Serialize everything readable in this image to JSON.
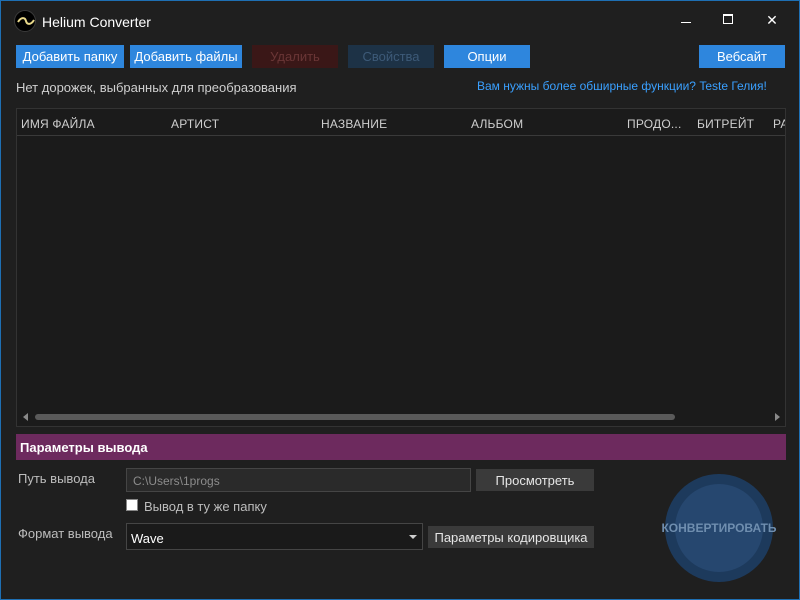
{
  "window": {
    "title": "Helium Converter"
  },
  "toolbar": {
    "add_folder": "Добавить папку",
    "add_files": "Добавить файлы",
    "delete": "Удалить",
    "properties": "Свойства",
    "options": "Опции",
    "website": "Вебсайт"
  },
  "status": {
    "no_tracks": "Нет дорожек, выбранных для преобразования",
    "promo_link": "Вам нужны более обширные функции? Teste Гелия!"
  },
  "tracklist": {
    "columns": [
      "ИМЯ ФАЙЛА",
      "АРТИСТ",
      "НАЗВАНИЕ",
      "АЛЬБОМ",
      "ПРОДО...",
      "БИТРЕЙТ",
      "РА"
    ]
  },
  "output": {
    "section_title": "Параметры вывода",
    "path_label": "Путь вывода",
    "path_value": "C:\\Users\\1progs",
    "browse_button": "Просмотреть",
    "same_folder_label": "Вывод в ту же папку",
    "same_folder_checked": false,
    "format_label": "Формат вывода",
    "format_value": "Wave",
    "encoder_button": "Параметры кодировщика",
    "convert_button": "КОНВЕРТИРОВАТЬ"
  },
  "icons": {
    "app": "helium-logo-icon",
    "minimize": "minimize-icon",
    "maximize": "maximize-icon",
    "close": "close-icon"
  },
  "colors": {
    "accent_blue": "#2e86dd",
    "section_header": "#6d2a5e",
    "link": "#3aa0ff",
    "background": "#1f1f1f"
  }
}
